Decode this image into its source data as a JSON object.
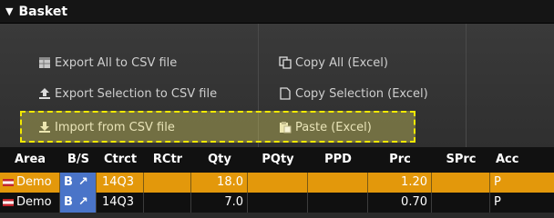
{
  "panel": {
    "title": "Basket"
  },
  "toolbar": {
    "export_all": "Export All to CSV file",
    "export_selection": "Export Selection to CSV file",
    "import_csv": "Import from CSV file",
    "copy_all": "Copy All (Excel)",
    "copy_selection": "Copy Selection (Excel)",
    "paste": "Paste (Excel)"
  },
  "table": {
    "columns": [
      "Area",
      "B/S",
      "Ctrct",
      "RCtr",
      "Qty",
      "PQty",
      "PPD",
      "Prc",
      "SPrc",
      "Acc"
    ],
    "rows": [
      {
        "area": "Demo",
        "bs": "B",
        "ctrct": "14Q3",
        "rctr": "",
        "qty": "18.0",
        "pqty": "",
        "ppd": "",
        "prc": "1.20",
        "sprc": "",
        "acc": "P"
      },
      {
        "area": "Demo",
        "bs": "B",
        "ctrct": "14Q3",
        "rctr": "",
        "qty": "7.0",
        "pqty": "",
        "ppd": "",
        "prc": "0.70",
        "sprc": "",
        "acc": "P"
      }
    ]
  },
  "colors": {
    "selected_row": "#e3980b",
    "buy_cell": "#4a74c8",
    "highlight_border": "#f3e900"
  }
}
